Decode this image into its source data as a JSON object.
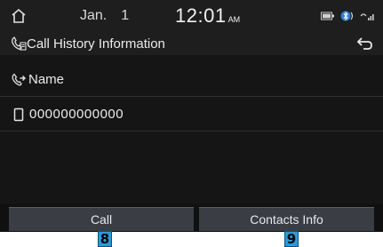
{
  "status_bar": {
    "month": "Jan.",
    "day": "1",
    "time": "12:01",
    "ampm": "AM",
    "icons": [
      "home-icon",
      "battery-icon",
      "bluetooth-phone-icon",
      "signal-icon"
    ]
  },
  "header": {
    "title": "Call History Information",
    "title_icon": "call-history-icon",
    "back_icon": "back-arrow-icon"
  },
  "details": {
    "name_label": "Name",
    "name_icon": "outgoing-call-icon",
    "number": "000000000000",
    "number_icon": "mobile-phone-icon"
  },
  "buttons": {
    "call_label": "Call",
    "contacts_label": "Contacts Info"
  },
  "markers": {
    "call": "8",
    "contacts": "9"
  },
  "colors": {
    "background": "#141414",
    "button": "#3a3d44",
    "marker": "#2b9bd8"
  }
}
